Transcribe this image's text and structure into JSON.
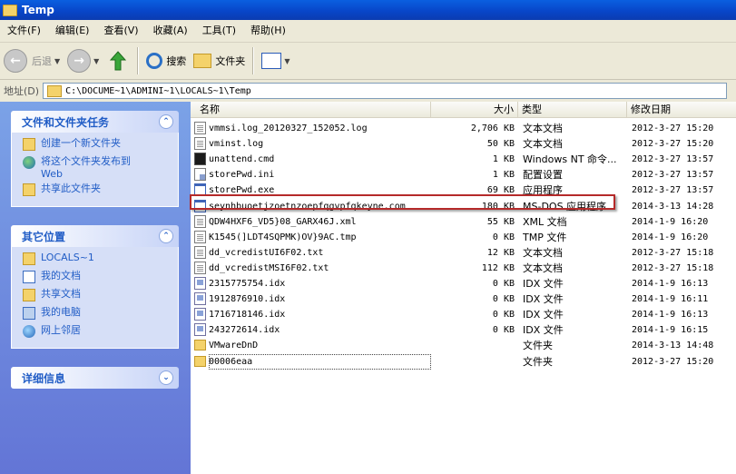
{
  "window": {
    "title": "Temp"
  },
  "menu": [
    "文件(F)",
    "编辑(E)",
    "查看(V)",
    "收藏(A)",
    "工具(T)",
    "帮助(H)"
  ],
  "toolbar": {
    "back": "后退",
    "search": "搜索",
    "folders": "文件夹"
  },
  "address": {
    "label": "地址(D)",
    "value": "C:\\DOCUME~1\\ADMINI~1\\LOCALS~1\\Temp"
  },
  "sidebar": {
    "tasks": {
      "title": "文件和文件夹任务",
      "items": [
        {
          "label": "创建一个新文件夹",
          "icon": "new-folder"
        },
        {
          "label": "将这个文件夹发布到 Web",
          "icon": "globe"
        },
        {
          "label": "共享此文件夹",
          "icon": "share-folder"
        }
      ]
    },
    "places": {
      "title": "其它位置",
      "items": [
        {
          "label": "LOCALS~1",
          "icon": "folder"
        },
        {
          "label": "我的文档",
          "icon": "documents"
        },
        {
          "label": "共享文档",
          "icon": "shared-folder"
        },
        {
          "label": "我的电脑",
          "icon": "computer"
        },
        {
          "label": "网上邻居",
          "icon": "network"
        }
      ]
    },
    "details": {
      "title": "详细信息"
    }
  },
  "columns": {
    "name": "名称",
    "size": "大小",
    "type": "类型",
    "modified": "修改日期"
  },
  "files": [
    {
      "name": "vmmsi.log_20120327_152052.log",
      "size": "2,706 KB",
      "type": "文本文档",
      "modified": "2012-3-27 15:20",
      "icon": "doc"
    },
    {
      "name": "vminst.log",
      "size": "50 KB",
      "type": "文本文档",
      "modified": "2012-3-27 15:20",
      "icon": "doc"
    },
    {
      "name": "unattend.cmd",
      "size": "1 KB",
      "type": "Windows NT 命令...",
      "modified": "2012-3-27 13:57",
      "icon": "cmd"
    },
    {
      "name": "storePwd.ini",
      "size": "1 KB",
      "type": "配置设置",
      "modified": "2012-3-27 13:57",
      "icon": "ini"
    },
    {
      "name": "storePwd.exe",
      "size": "69 KB",
      "type": "应用程序",
      "modified": "2012-3-27 13:57",
      "icon": "exe"
    },
    {
      "name": "seynhbuoetjzoetnzoepfqgvpfqkeyne.com",
      "size": "180 KB",
      "type": "MS-DOS 应用程序",
      "modified": "2014-3-13 14:28",
      "icon": "exe"
    },
    {
      "name": "QDW4HXF6_VD5}08_GARX46J.xml",
      "size": "55 KB",
      "type": "XML 文档",
      "modified": "2014-1-9 16:20",
      "icon": "doc"
    },
    {
      "name": "K1545(]LDT4SQPMK)OV}9AC.tmp",
      "size": "0 KB",
      "type": "TMP 文件",
      "modified": "2014-1-9 16:20",
      "icon": "doc"
    },
    {
      "name": "dd_vcredistUI6F02.txt",
      "size": "12 KB",
      "type": "文本文档",
      "modified": "2012-3-27 15:18",
      "icon": "doc"
    },
    {
      "name": "dd_vcredistMSI6F02.txt",
      "size": "112 KB",
      "type": "文本文档",
      "modified": "2012-3-27 15:18",
      "icon": "doc"
    },
    {
      "name": "2315775754.idx",
      "size": "0 KB",
      "type": "IDX 文件",
      "modified": "2014-1-9 16:13",
      "icon": "idx"
    },
    {
      "name": "1912876910.idx",
      "size": "0 KB",
      "type": "IDX 文件",
      "modified": "2014-1-9 16:11",
      "icon": "idx"
    },
    {
      "name": "1716718146.idx",
      "size": "0 KB",
      "type": "IDX 文件",
      "modified": "2014-1-9 16:13",
      "icon": "idx"
    },
    {
      "name": "243272614.idx",
      "size": "0 KB",
      "type": "IDX 文件",
      "modified": "2014-1-9 16:15",
      "icon": "idx"
    },
    {
      "name": "VMwareDnD",
      "size": "",
      "type": "文件夹",
      "modified": "2014-3-13 14:48",
      "icon": "folder"
    },
    {
      "name": "00006eaa",
      "size": "",
      "type": "文件夹",
      "modified": "2012-3-27 15:20",
      "icon": "folder"
    }
  ],
  "highlighted_file": "seynhbuoetjzoetnzoepfqgvpfqkeyne.com",
  "colors": {
    "title_bar": "#0846c9",
    "sidebar": "#7ba2e7",
    "task_text": "#215dc6",
    "highlight_border": "#b52a2a"
  }
}
